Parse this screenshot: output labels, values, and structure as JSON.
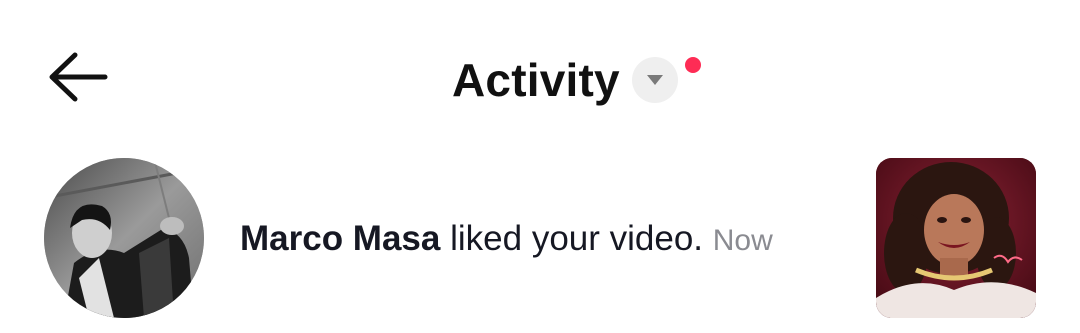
{
  "header": {
    "title": "Activity",
    "back_icon": "arrow-left-icon",
    "dropdown_icon": "caret-down-icon",
    "has_notification_dot": true
  },
  "colors": {
    "accent_dot": "#fe2c55",
    "text_primary": "#161823",
    "text_secondary": "#8a8b91",
    "dropdown_bg": "#efefef"
  },
  "activity": {
    "items": [
      {
        "username": "Marco Masa",
        "action": "liked your video.",
        "time": "Now"
      }
    ]
  }
}
